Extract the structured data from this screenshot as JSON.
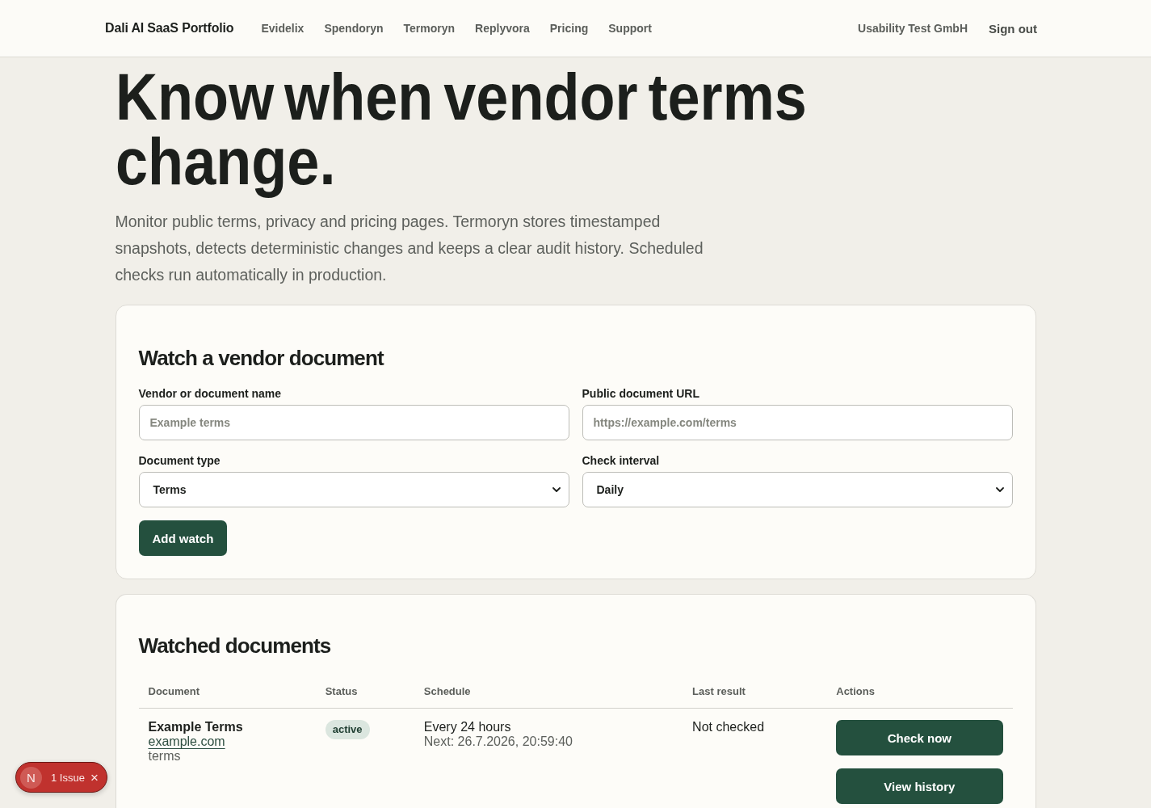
{
  "header": {
    "brand": "Dali AI SaaS Portfolio",
    "nav": [
      {
        "label": "Evidelix",
        "selected": false
      },
      {
        "label": "Spendoryn",
        "selected": false
      },
      {
        "label": "Termoryn",
        "selected": false
      },
      {
        "label": "Replyvora",
        "selected": false
      },
      {
        "label": "Pricing",
        "selected": false
      },
      {
        "label": "Support",
        "selected": false
      }
    ],
    "account": "Usability Test GmbH",
    "sign_out": "Sign out"
  },
  "hero": {
    "title": "Know when vendor terms change.",
    "description": "Monitor public terms, privacy and pricing pages. Termoryn stores timestamped snapshots, detects deterministic changes and keeps a clear audit history. Scheduled checks run automatically in production."
  },
  "watch_form": {
    "title": "Watch a vendor document",
    "fields": [
      {
        "kind": "text",
        "label": "Vendor or document name",
        "placeholder": "Example terms"
      },
      {
        "kind": "text",
        "label": "Public document URL",
        "placeholder": "https://example.com/terms"
      },
      {
        "kind": "select",
        "label": "Document type",
        "value": "Terms"
      },
      {
        "kind": "select",
        "label": "Check interval",
        "value": "Daily"
      }
    ],
    "submit": "Add watch"
  },
  "watched_documents": {
    "title": "Watched documents",
    "table": {
      "columns": [
        "Document",
        "Status",
        "Schedule",
        "Last result",
        "Actions"
      ],
      "rows": [
        {
          "document": {
            "name": "Example Terms",
            "url": "example.com",
            "type": "terms"
          },
          "status": "active",
          "schedule": {
            "interval": "Every 24 hours",
            "next": "Next: 26.7.2026, 20:59:40"
          },
          "last_result": "Not checked",
          "actions": [
            "Check now",
            "View history"
          ]
        }
      ]
    }
  },
  "dev_indicator": {
    "logo": "N",
    "issues": "1 Issue",
    "close": "×"
  }
}
